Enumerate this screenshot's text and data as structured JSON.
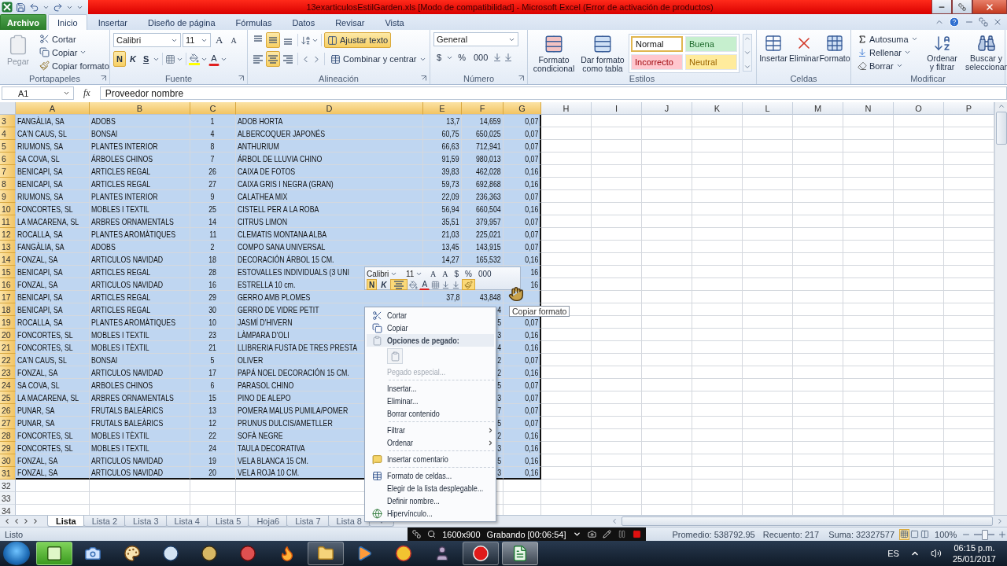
{
  "title_bar": {
    "title": "13exarticulosEstilGarden.xls  [Modo de compatibilidad]  -  Microsoft Excel (Error de activación de productos)"
  },
  "ribbon_tabs": [
    {
      "label": "Archivo",
      "kind": "file",
      "selected": false
    },
    {
      "label": "Inicio",
      "kind": "tab",
      "selected": true
    },
    {
      "label": "Insertar",
      "kind": "tab",
      "selected": false
    },
    {
      "label": "Diseño de página",
      "kind": "tab",
      "selected": false
    },
    {
      "label": "Fórmulas",
      "kind": "tab",
      "selected": false
    },
    {
      "label": "Datos",
      "kind": "tab",
      "selected": false
    },
    {
      "label": "Revisar",
      "kind": "tab",
      "selected": false
    },
    {
      "label": "Vista",
      "kind": "tab",
      "selected": false
    }
  ],
  "ribbon": {
    "clipboard": {
      "label": "Portapapeles",
      "paste": {
        "label": "Pegar",
        "disabled": true
      },
      "cut": "Cortar",
      "copy": "Copiar",
      "format_painter": "Copiar formato"
    },
    "font": {
      "label": "Fuente",
      "font_name": "Calibri",
      "font_size": "11",
      "grow": "A",
      "shrink": "A",
      "bold": {
        "label": "N",
        "on": true
      },
      "italic": {
        "label": "K",
        "on": false
      },
      "underline": {
        "label": "S",
        "on": false
      },
      "fill_color": {
        "color": "#ffff00"
      },
      "font_color": {
        "label": "A",
        "color": "#e02020"
      }
    },
    "alignment": {
      "label": "Alineación",
      "vertical": [
        {
          "selected": false
        },
        {
          "selected": true
        },
        {
          "selected": false
        }
      ],
      "horizontal": [
        {
          "selected": false
        },
        {
          "selected": true
        },
        {
          "selected": false
        }
      ],
      "wrap_text": {
        "label": "Ajustar texto",
        "on": true
      },
      "merge": {
        "label": "Combinar y centrar"
      }
    },
    "number": {
      "label": "Número",
      "format": "General",
      "currency": "$",
      "percent": "%",
      "thousands": "000"
    },
    "styles": {
      "label": "Estilos",
      "conditional": "Formato condicional",
      "as_table": "Dar formato como tabla",
      "cell_styles": [
        {
          "label": "Normal",
          "kind": "normal",
          "selected": true
        },
        {
          "label": "Buena",
          "kind": "good",
          "selected": false
        },
        {
          "label": "Incorrecto",
          "kind": "bad",
          "selected": false
        },
        {
          "label": "Neutral",
          "kind": "neutral",
          "selected": false
        }
      ]
    },
    "cells": {
      "label": "Celdas",
      "insert": "Insertar",
      "delete": "Eliminar",
      "format": "Formato"
    },
    "editing": {
      "label": "Modificar",
      "autosum": "Autosuma",
      "fill": "Rellenar",
      "clear": "Borrar",
      "sort": "Ordenar y filtrar",
      "find": "Buscar y seleccionar"
    }
  },
  "formula_bar": {
    "name_box": "A1",
    "function_label": "fx",
    "value": "Proveedor nombre"
  },
  "sheet": {
    "columns": [
      {
        "label": "A",
        "selected": true
      },
      {
        "label": "B",
        "selected": true
      },
      {
        "label": "C",
        "selected": true
      },
      {
        "label": "D",
        "selected": true
      },
      {
        "label": "E",
        "selected": true
      },
      {
        "label": "F",
        "selected": true
      },
      {
        "label": "G",
        "selected": true
      },
      {
        "label": "H",
        "selected": false
      },
      {
        "label": "I",
        "selected": false
      },
      {
        "label": "J",
        "selected": false
      },
      {
        "label": "K",
        "selected": false
      },
      {
        "label": "L",
        "selected": false
      },
      {
        "label": "M",
        "selected": false
      },
      {
        "label": "N",
        "selected": false
      },
      {
        "label": "O",
        "selected": false
      },
      {
        "label": "P",
        "selected": false
      }
    ],
    "rows": [
      {
        "number": "3",
        "selected": true,
        "cells": [
          "FANGÀLIA, SA",
          "ADOBS",
          "1",
          "ADOB HORTA",
          "13,7",
          "14,659",
          "0,07"
        ]
      },
      {
        "number": "4",
        "selected": true,
        "cells": [
          "CA'N CAUS, SL",
          "BONSAI",
          "4",
          "ALBERCOQUER JAPONÉS",
          "60,75",
          "650,025",
          "0,07"
        ]
      },
      {
        "number": "5",
        "selected": true,
        "cells": [
          "RIUMONS, SA",
          "PLANTES INTERIOR",
          "8",
          "ANTHURIUM",
          "66,63",
          "712,941",
          "0,07"
        ]
      },
      {
        "number": "6",
        "selected": true,
        "cells": [
          "SA COVA, SL",
          "ÁRBOLES CHINOS",
          "7",
          "ÁRBOL DE LLUVIA CHINO",
          "91,59",
          "980,013",
          "0,07"
        ]
      },
      {
        "number": "7",
        "selected": true,
        "cells": [
          "BENICAPI, SA",
          "ARTICLES REGAL",
          "26",
          "CAIXA DE FOTOS",
          "39,83",
          "462,028",
          "0,16"
        ]
      },
      {
        "number": "8",
        "selected": true,
        "cells": [
          "BENICAPI, SA",
          "ARTICLES REGAL",
          "27",
          "CAIXA GRIS I NEGRA (GRAN)",
          "59,73",
          "692,868",
          "0,16"
        ]
      },
      {
        "number": "9",
        "selected": true,
        "cells": [
          "RIUMONS, SA",
          "PLANTES INTERIOR",
          "9",
          "CALATHEA MIX",
          "22,09",
          "236,363",
          "0,07"
        ]
      },
      {
        "number": "10",
        "selected": true,
        "cells": [
          "FONCORTES, SL",
          "MOBLES I TEXTIL",
          "25",
          "CISTELL PER A LA ROBA",
          "56,94",
          "660,504",
          "0,16"
        ]
      },
      {
        "number": "11",
        "selected": true,
        "cells": [
          "LA MACARENA, SL",
          "ARBRES ORNAMENTALS",
          "14",
          "CITRUS LIMON",
          "35,51",
          "379,957",
          "0,07"
        ]
      },
      {
        "number": "12",
        "selected": true,
        "cells": [
          "ROCALLA, SA",
          "PLANTES AROMÀTIQUES",
          "11",
          "CLEMATIS MONTANA ALBA",
          "21,03",
          "225,021",
          "0,07"
        ]
      },
      {
        "number": "13",
        "selected": true,
        "cells": [
          "FANGÀLIA, SA",
          "ADOBS",
          "2",
          "COMPO SANA UNIVERSAL",
          "13,45",
          "143,915",
          "0,07"
        ]
      },
      {
        "number": "14",
        "selected": true,
        "cells": [
          "FONZAL, SA",
          "ARTICULOS NAVIDAD",
          "18",
          "DECORACIÓN ÁRBOL 15 CM.",
          "14,27",
          "165,532",
          "0,16"
        ]
      },
      {
        "number": "15",
        "selected": true,
        "cells": [
          "BENICAPI, SA",
          "ARTICLES REGAL",
          "28",
          "ESTOVALLES INDIVIDUALS (3 UNI",
          null,
          null,
          "16"
        ]
      },
      {
        "number": "16",
        "selected": true,
        "cells": [
          "FONZAL, SA",
          "ARTICULOS NAVIDAD",
          "16",
          "ESTRELLA 10 cm.",
          null,
          null,
          "16"
        ]
      },
      {
        "number": "17",
        "selected": true,
        "cells": [
          "BENICAPI, SA",
          "ARTICLES REGAL",
          "29",
          "GERRO AMB PLOMES",
          "37,8",
          "43,848",
          null
        ]
      },
      {
        "number": "18",
        "selected": true,
        "cells": [
          "BENICAPI, SA",
          "ARTICLES REGAL",
          "30",
          "GERRO DE VIDRE PETIT",
          null,
          "4",
          null
        ]
      },
      {
        "number": "19",
        "selected": true,
        "cells": [
          "ROCALLA, SA",
          "PLANTES AROMÀTIQUES",
          "10",
          "JASMÍ D'HIVERN",
          null,
          "5",
          "0,07"
        ]
      },
      {
        "number": "20",
        "selected": true,
        "cells": [
          "FONCORTES, SL",
          "MOBLES I TEXTIL",
          "23",
          "LÀMPARA D'OLI",
          null,
          "3",
          "0,16"
        ]
      },
      {
        "number": "21",
        "selected": true,
        "cells": [
          "FONCORTES, SL",
          "MOBLES I TÈXTIL",
          "21",
          "LLIBRERIA FUSTA DE TRES PRESTA",
          null,
          "4",
          "0,16"
        ]
      },
      {
        "number": "22",
        "selected": true,
        "cells": [
          "CA'N CAUS, SL",
          "BONSAI",
          "5",
          "OLIVER",
          null,
          "2",
          "0,07"
        ]
      },
      {
        "number": "23",
        "selected": true,
        "cells": [
          "FONZAL, SA",
          "ARTICULOS NAVIDAD",
          "17",
          "PAPÁ NOEL DECORACIÓN 15 CM.",
          null,
          "2",
          "0,16"
        ]
      },
      {
        "number": "24",
        "selected": true,
        "cells": [
          "SA COVA, SL",
          "ARBOLES CHINOS",
          "6",
          "PARASOL CHINO",
          null,
          "5",
          "0,07"
        ]
      },
      {
        "number": "25",
        "selected": true,
        "cells": [
          "LA MACARENA, SL",
          "ARBRES ORNAMENTALS",
          "15",
          "PINO DE ALEPO",
          null,
          "3",
          "0,07"
        ]
      },
      {
        "number": "26",
        "selected": true,
        "cells": [
          "PUNAR, SA",
          "FRUTALS BALEÀRICS",
          "13",
          "POMERA MALUS PUMILA/POMER",
          null,
          "7",
          "0,07"
        ]
      },
      {
        "number": "27",
        "selected": true,
        "cells": [
          "PUNAR, SA",
          "FRUTALS BALEÀRICS",
          "12",
          "PRUNUS DULCIS/AMETLLER",
          null,
          "5",
          "0,07"
        ]
      },
      {
        "number": "28",
        "selected": true,
        "cells": [
          "FONCORTES, SL",
          "MOBLES I TÈXTIL",
          "22",
          "SOFÀ NEGRE",
          null,
          "2",
          "0,16"
        ]
      },
      {
        "number": "29",
        "selected": true,
        "cells": [
          "FONCORTES, SL",
          "MOBLES I TEXTIL",
          "24",
          "TAULA DECORATIVA",
          null,
          "3",
          "0,16"
        ]
      },
      {
        "number": "30",
        "selected": true,
        "cells": [
          "FONZAL, SA",
          "ARTICULOS NAVIDAD",
          "19",
          "VELA BLANCA 15 CM.",
          null,
          "5",
          "0,16"
        ]
      },
      {
        "number": "31",
        "selected": true,
        "cells": [
          "FONZAL, SA",
          "ARTICULOS NAVIDAD",
          "20",
          "VELA ROJA 10 CM.",
          null,
          "3",
          "0,16"
        ]
      },
      {
        "number": "32",
        "selected": false
      },
      {
        "number": "33",
        "selected": false
      },
      {
        "number": "34",
        "selected": false
      }
    ]
  },
  "mini_toolbar": {
    "font_name": "Calibri",
    "font_size": "11",
    "grow": "A",
    "shrink": "A",
    "currency": "$",
    "percent": "%",
    "thousands": "000",
    "bold": {
      "label": "N",
      "on": true
    },
    "italic": {
      "label": "K",
      "on": false
    },
    "center": {
      "on": true
    },
    "font_color": {
      "label": "A",
      "color": "#e02020"
    }
  },
  "tooltip": "Copiar formato",
  "context_menu": [
    {
      "kind": "item",
      "label": "Cortar",
      "disabled": false
    },
    {
      "kind": "item",
      "label": "Copiar",
      "disabled": false
    },
    {
      "kind": "header",
      "label": "Opciones de pegado:"
    },
    {
      "kind": "paste_options"
    },
    {
      "kind": "item",
      "label": "Pegado especial...",
      "disabled": true
    },
    {
      "kind": "separator"
    },
    {
      "kind": "item",
      "label": "Insertar...",
      "disabled": false
    },
    {
      "kind": "item",
      "label": "Eliminar...",
      "disabled": false
    },
    {
      "kind": "item",
      "label": "Borrar contenido",
      "disabled": false
    },
    {
      "kind": "separator"
    },
    {
      "kind": "submenu",
      "label": "Filtrar"
    },
    {
      "kind": "submenu",
      "label": "Ordenar"
    },
    {
      "kind": "separator"
    },
    {
      "kind": "item",
      "label": "Insertar comentario",
      "disabled": false
    },
    {
      "kind": "separator"
    },
    {
      "kind": "item",
      "label": "Formato de celdas...",
      "disabled": false
    },
    {
      "kind": "item",
      "label": "Elegir de la lista desplegable...",
      "disabled": false
    },
    {
      "kind": "item",
      "label": "Definir nombre...",
      "disabled": false
    },
    {
      "kind": "item",
      "label": "Hipervínculo...",
      "disabled": false
    }
  ],
  "sheet_tabs": [
    {
      "label": "Lista",
      "selected": true
    },
    {
      "label": "Lista 2",
      "selected": false
    },
    {
      "label": "Lista 3",
      "selected": false
    },
    {
      "label": "Lista 4",
      "selected": false
    },
    {
      "label": "Lista 5",
      "selected": false
    },
    {
      "label": "Hoja6",
      "selected": false
    },
    {
      "label": "Lista 7",
      "selected": false
    },
    {
      "label": "Lista 8",
      "selected": false
    }
  ],
  "status_bar": {
    "ready": "Listo",
    "average": "Promedio: 538792.95",
    "count": "Recuento: 217",
    "sum": "Suma: 32327577",
    "views": [
      {
        "selected": true
      },
      {
        "selected": false
      },
      {
        "selected": false
      }
    ],
    "zoom": "100%",
    "zoom_slider": {
      "level": 0.5
    }
  },
  "recorder": {
    "resolution": "1600x900",
    "status": "Grabando [00:06:54]"
  },
  "taskbar": {
    "apps": [
      {
        "open": true,
        "highlighted": true
      },
      {
        "open": false,
        "highlighted": false
      },
      {
        "open": false,
        "highlighted": false
      },
      {
        "open": false,
        "highlighted": false
      },
      {
        "open": false,
        "highlighted": false
      },
      {
        "open": false,
        "highlighted": false
      },
      {
        "open": false,
        "highlighted": false
      },
      {
        "open": true,
        "highlighted": false
      },
      {
        "open": false,
        "highlighted": false
      },
      {
        "open": false,
        "highlighted": false
      },
      {
        "open": false,
        "highlighted": false
      },
      {
        "open": true,
        "highlighted": false
      },
      {
        "open": true,
        "highlighted": true
      }
    ],
    "language": "ES",
    "time": "06:15 p.m.",
    "date": "25/01/2017"
  }
}
